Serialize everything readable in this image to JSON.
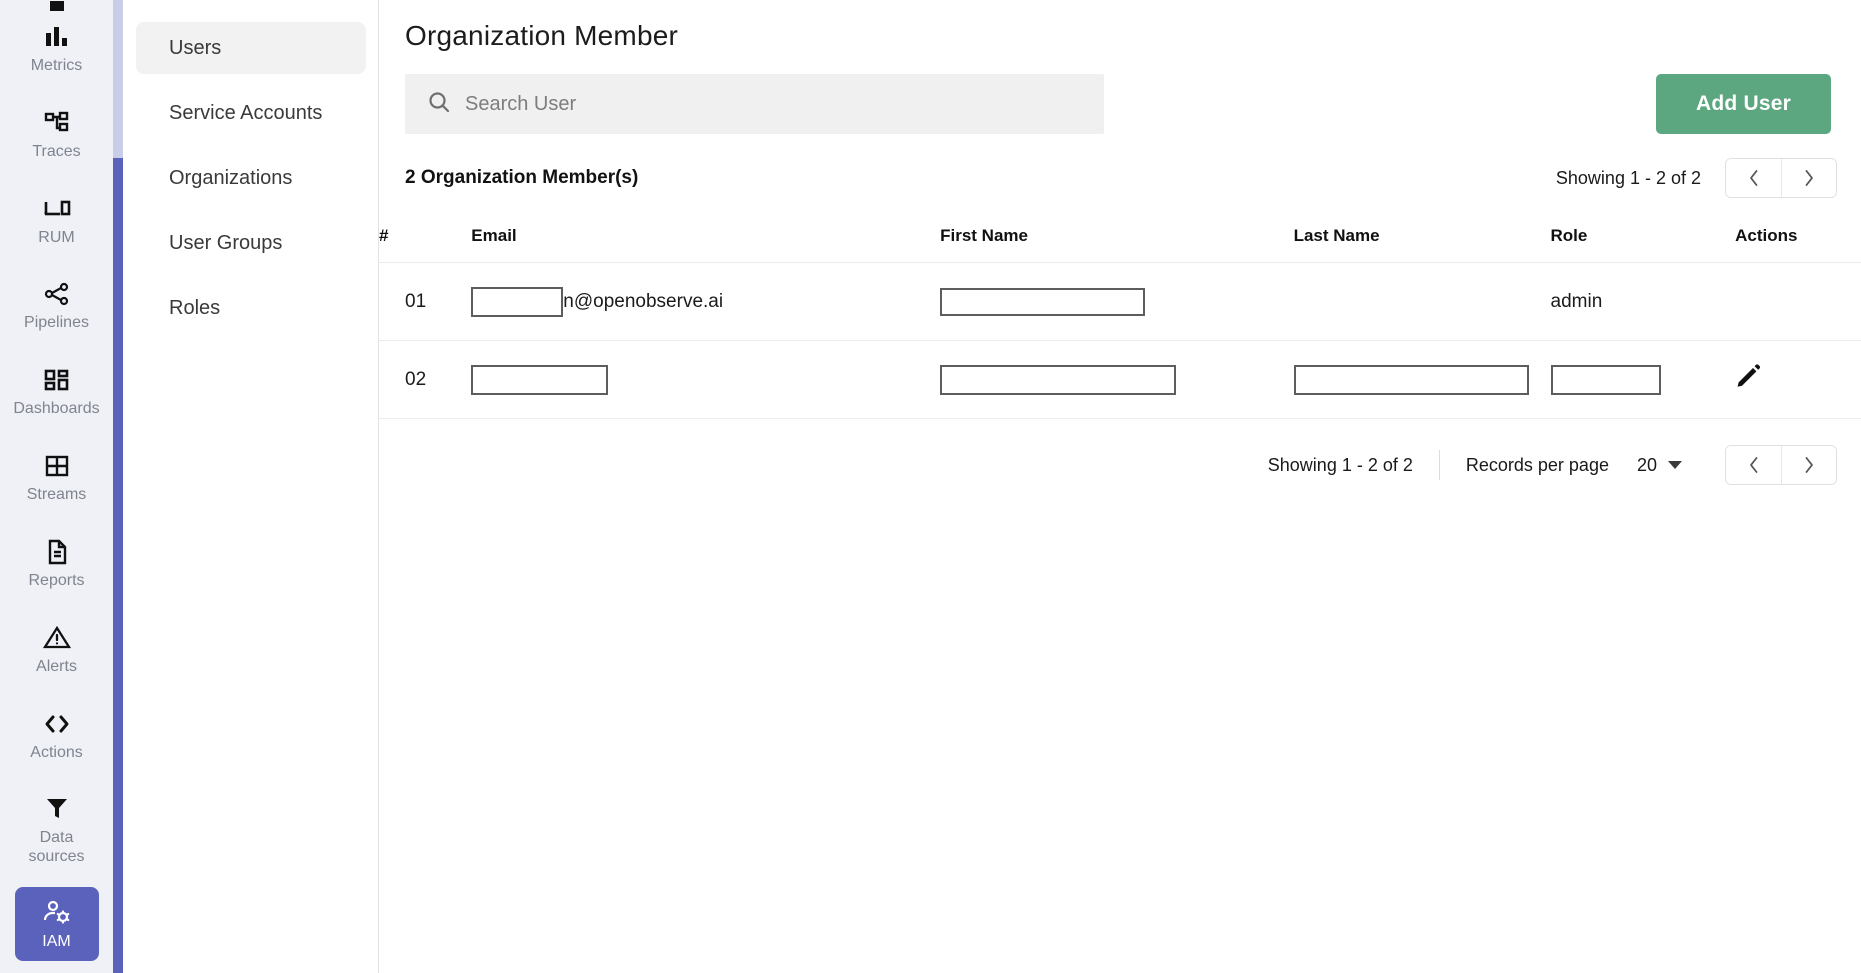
{
  "rail": {
    "items": [
      {
        "label": "Metrics",
        "icon": "bar-chart-icon",
        "active": false
      },
      {
        "label": "Traces",
        "icon": "traces-node-icon",
        "active": false
      },
      {
        "label": "RUM",
        "icon": "devices-icon",
        "active": false
      },
      {
        "label": "Pipelines",
        "icon": "share-nodes-icon",
        "active": false
      },
      {
        "label": "Dashboards",
        "icon": "dashboard-grid-icon",
        "active": false
      },
      {
        "label": "Streams",
        "icon": "table-grid-icon",
        "active": false
      },
      {
        "label": "Reports",
        "icon": "document-icon",
        "active": false
      },
      {
        "label": "Alerts",
        "icon": "warning-triangle-icon",
        "active": false
      },
      {
        "label": "Actions",
        "icon": "code-brackets-icon",
        "active": false
      },
      {
        "label": "Data sources",
        "icon": "funnel-icon",
        "active": false
      },
      {
        "label": "IAM",
        "icon": "user-gear-icon",
        "active": true
      }
    ]
  },
  "subnav": {
    "items": [
      {
        "label": "Users",
        "active": true
      },
      {
        "label": "Service Accounts",
        "active": false
      },
      {
        "label": "Organizations",
        "active": false
      },
      {
        "label": "User Groups",
        "active": false
      },
      {
        "label": "Roles",
        "active": false
      }
    ]
  },
  "header": {
    "title": "Organization Member"
  },
  "search": {
    "placeholder": "Search User",
    "value": "",
    "icon": "search-icon"
  },
  "toolbar": {
    "add_user_label": "Add User",
    "add_user_color": "#5ca77f"
  },
  "summary": {
    "count_label": "2 Organization Member(s)",
    "showing": "Showing 1 - 2 of 2",
    "prev_icon": "chevron-left-icon",
    "next_icon": "chevron-right-icon"
  },
  "table": {
    "columns": [
      "#",
      "Email",
      "First Name",
      "Last Name",
      "Role",
      "Actions"
    ],
    "rows": [
      {
        "index": "01",
        "email_redacted_width": 92,
        "email_visible": "n@openobserve.ai",
        "first_name_redacted_width": 205,
        "last_name_redacted_width": 0,
        "role": "admin",
        "role_redacted_width": 0,
        "action_icon": ""
      },
      {
        "index": "02",
        "email_redacted_width": 137,
        "email_visible": "",
        "first_name_redacted_width": 236,
        "last_name_redacted_width": 235,
        "role": "",
        "role_redacted_width": 110,
        "action_icon": "edit-pencil-icon"
      }
    ]
  },
  "footer": {
    "showing": "Showing 1 - 2 of 2",
    "records_per_page_label": "Records per page",
    "records_per_page_value": "20",
    "caret_icon": "chevron-down-icon",
    "prev_icon": "chevron-left-icon",
    "next_icon": "chevron-right-icon"
  }
}
